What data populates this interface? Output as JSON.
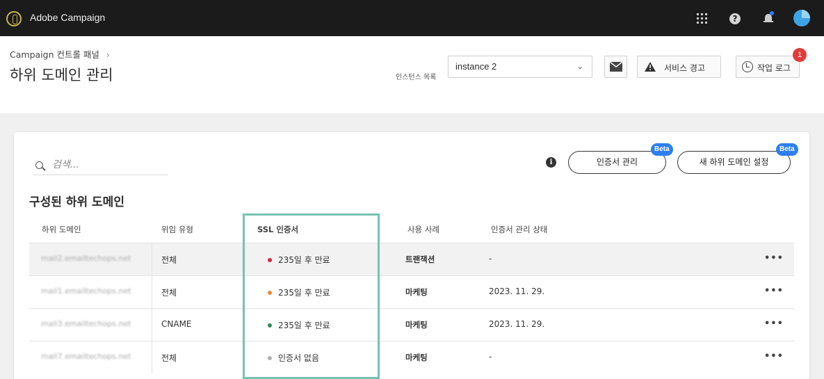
{
  "app": {
    "title": "Adobe Campaign"
  },
  "topbar": {
    "icons": [
      "apps-grid-icon",
      "help-icon",
      "bell-icon",
      "avatar"
    ]
  },
  "header": {
    "breadcrumb": "Campaign 컨트롤 패널",
    "breadcrumb_sep": "›",
    "title": "하위 도메인 관리",
    "instance_label": "인스턴스 목록",
    "instance_value": "instance 2",
    "alert_label": "서비스 경고",
    "log_label": "작업 로그",
    "log_badge": "1"
  },
  "toolbar": {
    "search_placeholder": "검색...",
    "cert_button": "인증서 관리",
    "new_button": "새 하위 도메인 설정",
    "beta_label": "Beta"
  },
  "section_title": "구성된 하위 도메인",
  "table": {
    "headers": [
      "하위 도메인",
      "위임 유형",
      "SSL 인증서",
      "사용 사례",
      "인증서 관리 상태"
    ],
    "rows": [
      {
        "domain": "mail2.emailtechops.net",
        "delegation": "전체",
        "ssl": "235일 후 만료",
        "ssl_color": "#d7263d",
        "use_case": "트랜잭션",
        "status": "-"
      },
      {
        "domain": "mail1.emailtechops.net",
        "delegation": "전체",
        "ssl": "235일 후 만료",
        "ssl_color": "#e8883a",
        "use_case": "마케팅",
        "status": "2023. 11. 29."
      },
      {
        "domain": "mail3.emailtechops.net",
        "delegation": "CNAME",
        "ssl": "235일 후 만료",
        "ssl_color": "#2e8b57",
        "use_case": "마케팅",
        "status": "2023. 11. 29."
      },
      {
        "domain": "mail7.emailtechops.net",
        "delegation": "전체",
        "ssl": "인증서 없음",
        "ssl_color": "#b0b0b0",
        "use_case": "마케팅",
        "status": "-"
      }
    ],
    "more_label": "•••"
  },
  "colors": {
    "highlight": "#76c2b0",
    "beta": "#2d7ff0",
    "badge": "#e03c3c"
  }
}
